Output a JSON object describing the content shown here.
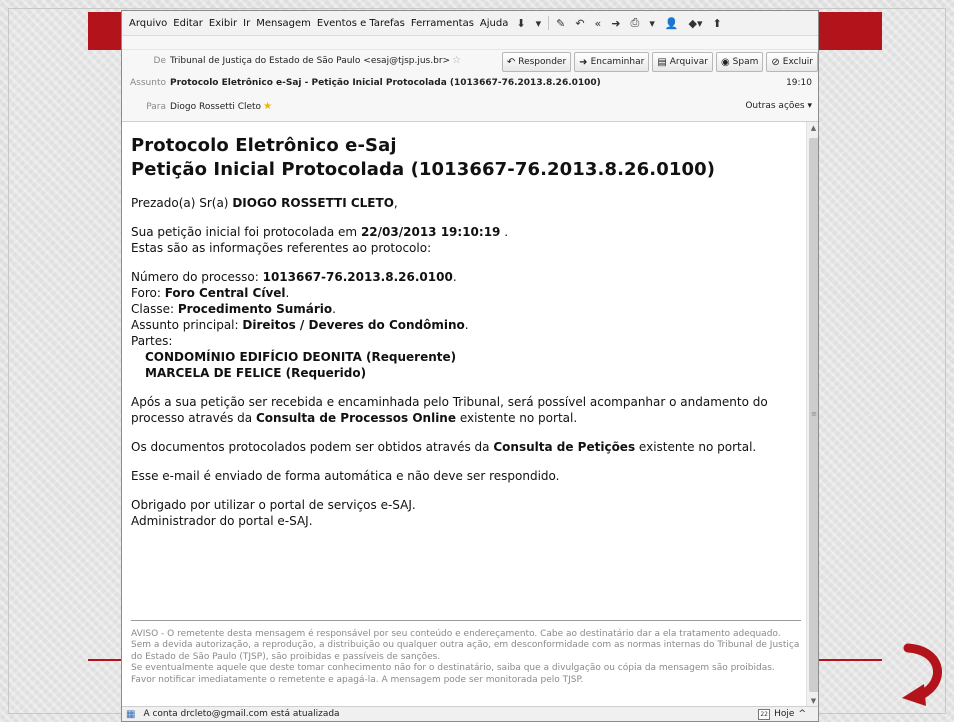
{
  "menubar": {
    "items": [
      "Arquivo",
      "Editar",
      "Exibir",
      "Ir",
      "Mensagem",
      "Eventos e Tarefas",
      "Ferramentas",
      "Ajuda"
    ],
    "toolbar_icons": [
      "get-mail-icon",
      "write-icon",
      "reply-icon",
      "reply-all-icon",
      "forward-icon",
      "print-icon",
      "address-book-icon",
      "tag-icon",
      "junk-icon"
    ]
  },
  "header": {
    "from_label": "De",
    "from_value": "Tribunal de Justiça do Estado de São Paulo <esaj@tjsp.jus.br>",
    "subject_label": "Assunto",
    "subject_value": "Protocolo Eletrônico e-Saj - Petição Inicial Protocolada (1013667-76.2013.8.26.0100)",
    "time": "19:10",
    "to_label": "Para",
    "to_value": "Diogo Rossetti Cleto",
    "other_actions": "Outras ações ▾",
    "actions": {
      "reply": "Responder",
      "forward": "Encaminhar",
      "archive": "Arquivar",
      "spam": "Spam",
      "delete": "Excluir"
    }
  },
  "message": {
    "title_line1": "Protocolo Eletrônico e-Saj",
    "title_line2": "Petição Inicial Protocolada (1013667-76.2013.8.26.0100)",
    "greeting_prefix": "Prezado(a) Sr(a)",
    "greeting_name": "DIOGO ROSSETTI CLETO",
    "greeting_suffix": ",",
    "intro_prefix": "Sua petição inicial foi protocolada em",
    "intro_datetime": "22/03/2013 19:10:19",
    "intro_suffix": ".",
    "intro_line2": "Estas são as informações referentes ao protocolo:",
    "process_label": "Número do processo:",
    "process_value": "1013667-76.2013.8.26.0100",
    "forum_label": "Foro:",
    "forum_value": "Foro Central Cível",
    "class_label": "Classe:",
    "class_value": "Procedimento Sumário",
    "subject_label": "Assunto principal:",
    "subject_value": "Direitos / Deveres do Condômino",
    "parties_label": "Partes:",
    "parties": [
      "CONDOMÍNIO EDIFÍCIO DEONITA (Requerente)",
      "MARCELA DE FELICE (Requerido)"
    ],
    "para1_prefix": "Após a sua petição ser recebida e encaminhada pelo Tribunal, será possível acompanhar o andamento do processo através da",
    "para1_bold": "Consulta de Processos Online",
    "para1_suffix": "existente no portal.",
    "para2_prefix": "Os documentos protocolados podem ser obtidos através da",
    "para2_bold": "Consulta de Petições",
    "para2_suffix": "existente no portal.",
    "para3": "Esse e-mail é enviado de forma automática e não deve ser respondido.",
    "sign_line1": "Obrigado por utilizar o portal de serviços e-SAJ.",
    "sign_line2": "Administrador do portal e-SAJ.",
    "disclaimer_1": "AVISO - O remetente desta mensagem é responsável por seu conteúdo e endereçamento. Cabe ao destinatário dar a ela tratamento adequado. Sem a devida autorização, a reprodução, a distribuição ou qualquer outra ação, em desconformidade com as normas internas do Tribunal de Justiça do Estado de São Paulo (TJSP), são proibidas e passíveis de sanções.",
    "disclaimer_2": "Se eventualmente aquele que deste tomar conhecimento não for o destinatário, saiba que a divulgação ou cópia da mensagem são proibidas. Favor notificar imediatamente o remetente e apagá-la. A mensagem pode ser monitorada pelo TJSP."
  },
  "statusbar": {
    "text": "A conta drcleto@gmail.com está atualizada",
    "today": "Hoje",
    "calendar_day": "22",
    "toggle": "^"
  },
  "colors": {
    "accent_red": "#b3141b",
    "window_bg": "#ffffff",
    "chrome_bg": "#f2f2f2"
  }
}
